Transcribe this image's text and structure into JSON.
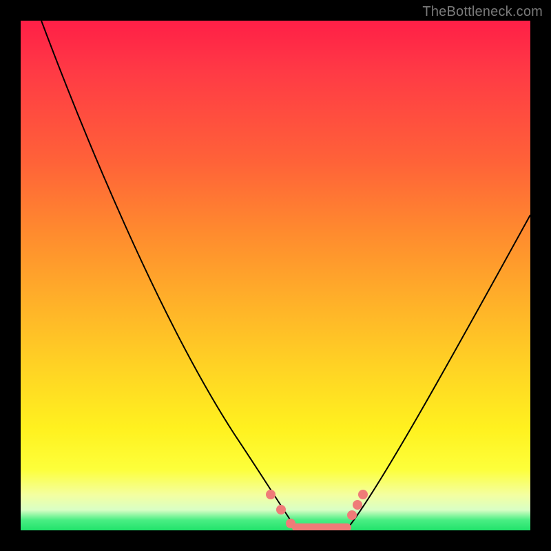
{
  "watermark": "TheBottleneck.com",
  "colors": {
    "bead": "#ef7b78",
    "curve": "#000000",
    "frame": "#000000",
    "gradient_top": "#ff1f47",
    "gradient_mid": "#ffd324",
    "gradient_bottom": "#21e36b"
  },
  "chart_data": {
    "type": "line",
    "title": "",
    "xlabel": "",
    "ylabel": "",
    "xlim": [
      0,
      100
    ],
    "ylim": [
      0,
      100
    ],
    "grid": false,
    "legend": false,
    "series": [
      {
        "name": "left-branch",
        "x": [
          4,
          10,
          16,
          22,
          28,
          34,
          40,
          45,
          48,
          50,
          52,
          54
        ],
        "y": [
          100,
          88,
          76,
          64,
          52,
          40,
          28,
          17,
          10,
          5,
          2,
          0
        ]
      },
      {
        "name": "floor",
        "x": [
          54,
          56,
          58,
          60,
          62,
          64
        ],
        "y": [
          0,
          0,
          0,
          0,
          0,
          0
        ]
      },
      {
        "name": "right-branch",
        "x": [
          64,
          68,
          74,
          80,
          86,
          92,
          98,
          100
        ],
        "y": [
          2,
          8,
          18,
          28,
          38,
          48,
          58,
          62
        ]
      }
    ],
    "markers": {
      "name": "beads",
      "color": "#ef7b78",
      "points": [
        {
          "x": 49,
          "y": 7
        },
        {
          "x": 51,
          "y": 4
        },
        {
          "x": 53,
          "y": 1
        },
        {
          "x": 65,
          "y": 3
        },
        {
          "x": 66,
          "y": 5
        },
        {
          "x": 67,
          "y": 7
        }
      ],
      "floor_bar": {
        "x0": 54,
        "x1": 64,
        "y": 0
      }
    },
    "annotations": [
      {
        "text": "TheBottleneck.com",
        "position": "top-right"
      }
    ]
  }
}
